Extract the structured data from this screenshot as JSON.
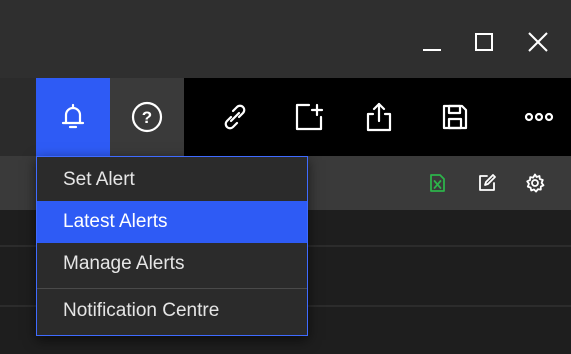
{
  "window_controls": {
    "minimize_icon": "minimize-icon",
    "maximize_icon": "maximize-icon",
    "close_icon": "close-icon"
  },
  "toolbar": {
    "buttons": [
      {
        "icon": "bell-icon",
        "active": true
      },
      {
        "icon": "help-icon"
      },
      {
        "icon": "link-icon"
      },
      {
        "icon": "add-window-icon"
      },
      {
        "icon": "share-icon"
      },
      {
        "icon": "save-icon"
      },
      {
        "icon": "more-icon"
      }
    ],
    "help_glyph": "?"
  },
  "alert_menu": {
    "items": [
      {
        "label": "Set Alert"
      },
      {
        "label": "Latest Alerts",
        "highlighted": true
      },
      {
        "label": "Manage Alerts"
      },
      {
        "label": "Notification Centre"
      }
    ]
  },
  "subbar": {
    "icons": [
      "excel-icon",
      "edit-icon",
      "settings-icon"
    ],
    "excel_color": "#2db34a"
  },
  "colors": {
    "accent": "#2e5bf5",
    "menu_border": "#3f6bff"
  }
}
